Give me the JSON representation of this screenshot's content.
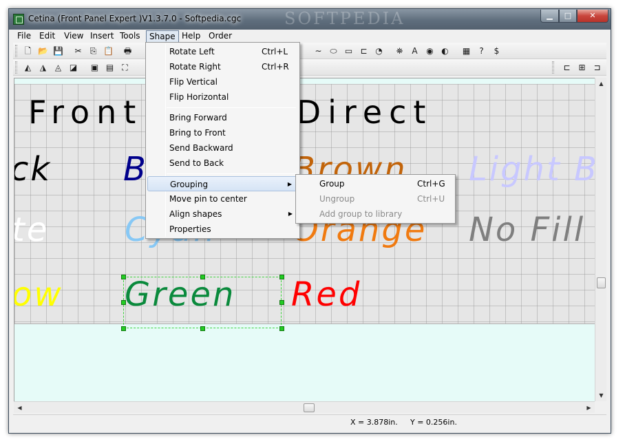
{
  "window": {
    "title": "Cetina (Front Panel Expert )V1.3.7.0 - Softpedia.cgc",
    "watermark": "SOFTPEDIA",
    "controls": {
      "minimize": "▁",
      "maximize": "□",
      "close": "✕"
    }
  },
  "menubar": {
    "items": [
      "File",
      "Edit",
      "View",
      "Insert",
      "Tools",
      "Shape",
      "Help",
      "Order"
    ],
    "active": "Shape"
  },
  "toolbar1": {
    "icons": [
      "new-file-icon",
      "open-folder-icon",
      "save-icon",
      "cut-icon",
      "copy-icon",
      "paste-icon",
      "print-icon",
      "curve-icon",
      "ellipse-icon",
      "rectangle-icon",
      "rounded-rect-icon",
      "arc-icon",
      "pin-icon",
      "text-icon",
      "eye-icon",
      "shape-icon",
      "grid-icon",
      "help-pointer-icon",
      "dollar-icon"
    ],
    "glyphs": [
      "🗋",
      "📂",
      "💾",
      "✂",
      "⎘",
      "📋",
      "🖶",
      "∼",
      "⬭",
      "▭",
      "⊏",
      "◔",
      "⛯",
      "A",
      "◉",
      "◐",
      "▦",
      "?",
      "$"
    ]
  },
  "toolbar2": {
    "icons": [
      "rotate-left-icon",
      "flip-vertical-icon",
      "rotate-right-icon",
      "flip-horizontal-icon",
      "bring-forward-icon",
      "send-backward-icon",
      "resize-icon",
      "align-left-icon",
      "align-center-icon",
      "align-right-icon"
    ],
    "glyphs": [
      "◭",
      "◮",
      "◬",
      "◪",
      "▣",
      "▤",
      "⛶",
      "⊏",
      "⊞",
      "⊐"
    ]
  },
  "canvas": {
    "title_text": "Front Panel Direct",
    "labels": [
      {
        "text": "ck",
        "color": "#000000"
      },
      {
        "text": "B",
        "color": "#00008b"
      },
      {
        "text": "Brown",
        "color": "#c2640a"
      },
      {
        "text": "Light B",
        "color": "#c8c8ff"
      },
      {
        "text": "te",
        "color": "#ffffff"
      },
      {
        "text": "Cyan",
        "color": "#87c8f5"
      },
      {
        "text": "Orange",
        "color": "#f07a10"
      },
      {
        "text": "No Fill",
        "color": "#7f7f7f"
      },
      {
        "text": "ow",
        "color": "#ffff00"
      },
      {
        "text": "Green",
        "color": "#0a8a3c"
      },
      {
        "text": "Red",
        "color": "#ff0000"
      }
    ]
  },
  "shape_menu": {
    "items": [
      {
        "label": "Rotate Left",
        "shortcut": "Ctrl+L"
      },
      {
        "label": "Rotate Right",
        "shortcut": "Ctrl+R"
      },
      {
        "label": "Flip Vertical",
        "shortcut": ""
      },
      {
        "label": "Flip Horizontal",
        "shortcut": ""
      },
      {
        "label": "Bring Forward",
        "shortcut": ""
      },
      {
        "label": "Bring to Front",
        "shortcut": ""
      },
      {
        "label": "Send Backward",
        "shortcut": ""
      },
      {
        "label": "Send to Back",
        "shortcut": ""
      },
      {
        "label": "Grouping",
        "shortcut": "",
        "submenu": true
      },
      {
        "label": "Move pin to center",
        "shortcut": ""
      },
      {
        "label": "Align shapes",
        "shortcut": "",
        "submenu": true
      },
      {
        "label": "Properties",
        "shortcut": ""
      }
    ],
    "highlighted": "Grouping"
  },
  "grouping_menu": {
    "items": [
      {
        "label": "Group",
        "shortcut": "Ctrl+G",
        "enabled": true
      },
      {
        "label": "Ungroup",
        "shortcut": "Ctrl+U",
        "enabled": false
      },
      {
        "label": "Add group to library",
        "shortcut": "",
        "enabled": false
      }
    ]
  },
  "statusbar": {
    "x": "X = 3.878in.",
    "y": "Y = 0.256in."
  },
  "scrollbar_glyphs": {
    "up": "▲",
    "down": "▼",
    "left": "◀",
    "right": "▶",
    "submenu": "▶"
  }
}
